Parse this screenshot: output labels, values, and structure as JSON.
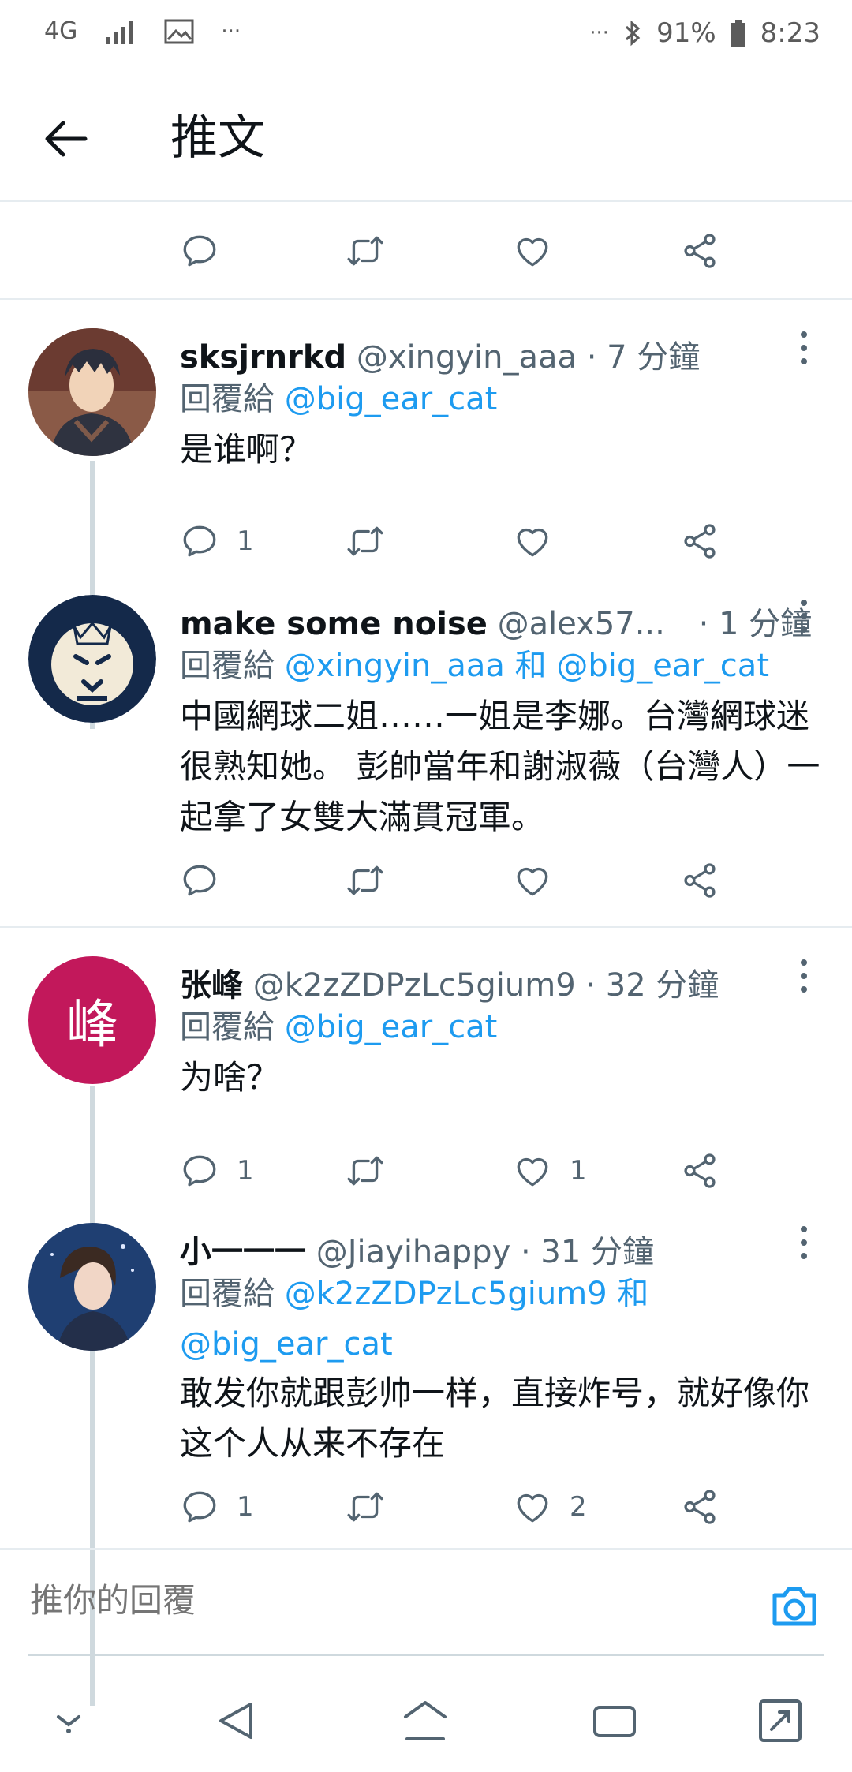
{
  "status_bar": {
    "network": "4G",
    "battery": "91%",
    "time": "8:23",
    "dots": "···"
  },
  "header": {
    "title": "推文"
  },
  "colors": {
    "accent": "#1d9bf0",
    "muted": "#536471",
    "line": "#cfd9de"
  },
  "tweets": [
    {
      "name": "sksjrnrkd",
      "handle": "@xingyin_aaa",
      "time": "· 7 分鐘",
      "reply_prefix": "回覆給",
      "mentions": "@big_ear_cat",
      "text": "是谁啊？",
      "reply_count": "1",
      "like_count": ""
    },
    {
      "name": "make some noise",
      "handle": "@alex57...",
      "time": "· 1 分鐘",
      "reply_prefix": "回覆給",
      "mentions": "@xingyin_aaa 和 @big_ear_cat",
      "text": "中國網球二姐……一姐是李娜。台灣網球迷很熟知她。 彭帥當年和謝淑薇（台灣人）一起拿了女雙大滿貫冠軍。",
      "reply_count": "",
      "like_count": ""
    },
    {
      "name": "张峰",
      "handle": "@k2zZDPzLc5gium9",
      "time": "· 32 分鐘",
      "reply_prefix": "回覆給",
      "mentions": "@big_ear_cat",
      "text": "为啥？",
      "reply_count": "1",
      "like_count": "1",
      "avatar_char": "峰"
    },
    {
      "name": "小一一一",
      "handle": "@Jiayihappy",
      "time": "· 31 分鐘",
      "reply_prefix": "回覆給",
      "mentions": "@k2zZDPzLc5gium9 和 @big_ear_cat",
      "text": "敢发你就跟彭帅一样，直接炸号，就好像你这个人从来不存在",
      "reply_count": "1",
      "like_count": "2"
    }
  ],
  "compose": {
    "placeholder": "推你的回覆"
  }
}
